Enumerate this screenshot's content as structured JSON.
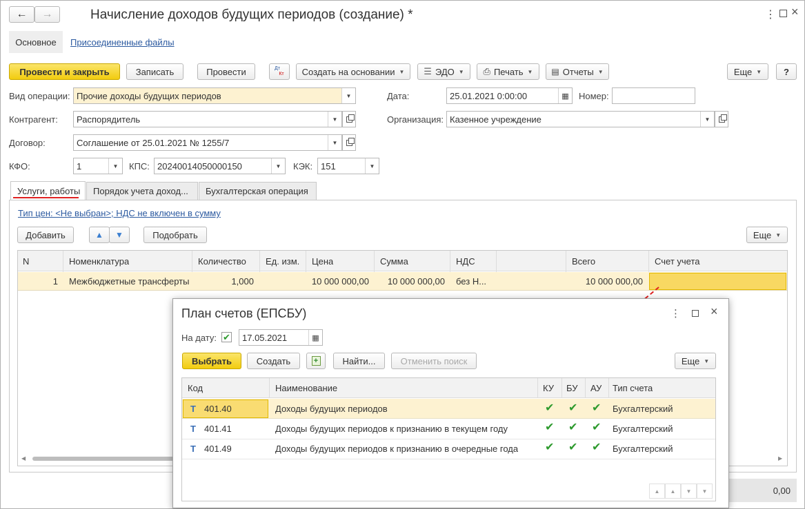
{
  "window": {
    "title": "Начисление доходов будущих периодов (создание) *",
    "nav_tabs": [
      "Основное",
      "Присоединенные файлы"
    ]
  },
  "toolbar": {
    "post_close": "Провести и закрыть",
    "save": "Записать",
    "post": "Провести",
    "dtkt_top": "Дт",
    "dtkt_bottom": "Кт",
    "create_based": "Создать на основании",
    "edo": "ЭДО",
    "print": "Печать",
    "reports": "Отчеты",
    "more": "Еще",
    "help": "?"
  },
  "form": {
    "op_type_label": "Вид операции:",
    "op_type_value": "Прочие доходы будущих периодов",
    "date_label": "Дата:",
    "date_value": "25.01.2021  0:00:00",
    "number_label": "Номер:",
    "number_value": "",
    "counterparty_label": "Контрагент:",
    "counterparty_value": "Распорядитель",
    "org_label": "Организация:",
    "org_value": "Казенное учреждение",
    "contract_label": "Договор:",
    "contract_value": "Соглашение от 25.01.2021 № 1255/7",
    "kfo_label": "КФО:",
    "kfo_value": "1",
    "kps_label": "КПС:",
    "kps_value": "20240014050000150",
    "kek_label": "КЭК:",
    "kek_value": "151"
  },
  "tabs": [
    "Услуги, работы",
    "Порядок учета доход...",
    "Бухгалтерская операция"
  ],
  "services": {
    "price_link": "Тип цен: <Не выбран>; НДС не включен в сумму",
    "add": "Добавить",
    "pick": "Подобрать",
    "more": "Еще",
    "columns": [
      "N",
      "Номенклатура",
      "Количество",
      "Ед. изм.",
      "Цена",
      "Сумма",
      "НДС",
      "",
      "Всего",
      "Счет учета"
    ],
    "row": {
      "n": "1",
      "item": "Межбюджетные трансферты",
      "qty": "1,000",
      "unit": "",
      "price": "10 000 000,00",
      "sum": "10 000 000,00",
      "vat": "без Н...",
      "vat_sum": "",
      "total": "10 000 000,00",
      "account": ""
    },
    "footer_total": "0,00"
  },
  "dialog": {
    "title": "План счетов (ЕПСБУ)",
    "date_label": "На дату:",
    "date_value": "17.05.2021",
    "select": "Выбрать",
    "create": "Создать",
    "find": "Найти...",
    "cancel_search": "Отменить поиск",
    "more": "Еще",
    "columns": [
      "Код",
      "Наименование",
      "КУ",
      "БУ",
      "АУ",
      "Тип счета"
    ],
    "rows": [
      {
        "type_icon": "Т",
        "code": "401.40",
        "name": "Доходы будущих периодов",
        "ku": "✔",
        "bu": "✔",
        "au": "✔",
        "account_type": "Бухгалтерский"
      },
      {
        "type_icon": "Т",
        "code": "401.41",
        "name": "Доходы будущих периодов к признанию в текущем году",
        "ku": "✔",
        "bu": "✔",
        "au": "✔",
        "account_type": "Бухгалтерский"
      },
      {
        "type_icon": "Т",
        "code": "401.49",
        "name": "Доходы будущих периодов к признанию в очередные года",
        "ku": "✔",
        "bu": "✔",
        "au": "✔",
        "account_type": "Бухгалтерский"
      }
    ]
  },
  "colors": {
    "accent_yellow": "#f5d31b",
    "selection_row": "#fdf2d1",
    "link_blue": "#2c5aa0",
    "check_green": "#2e9a2e",
    "annotation_red": "#e02020"
  }
}
